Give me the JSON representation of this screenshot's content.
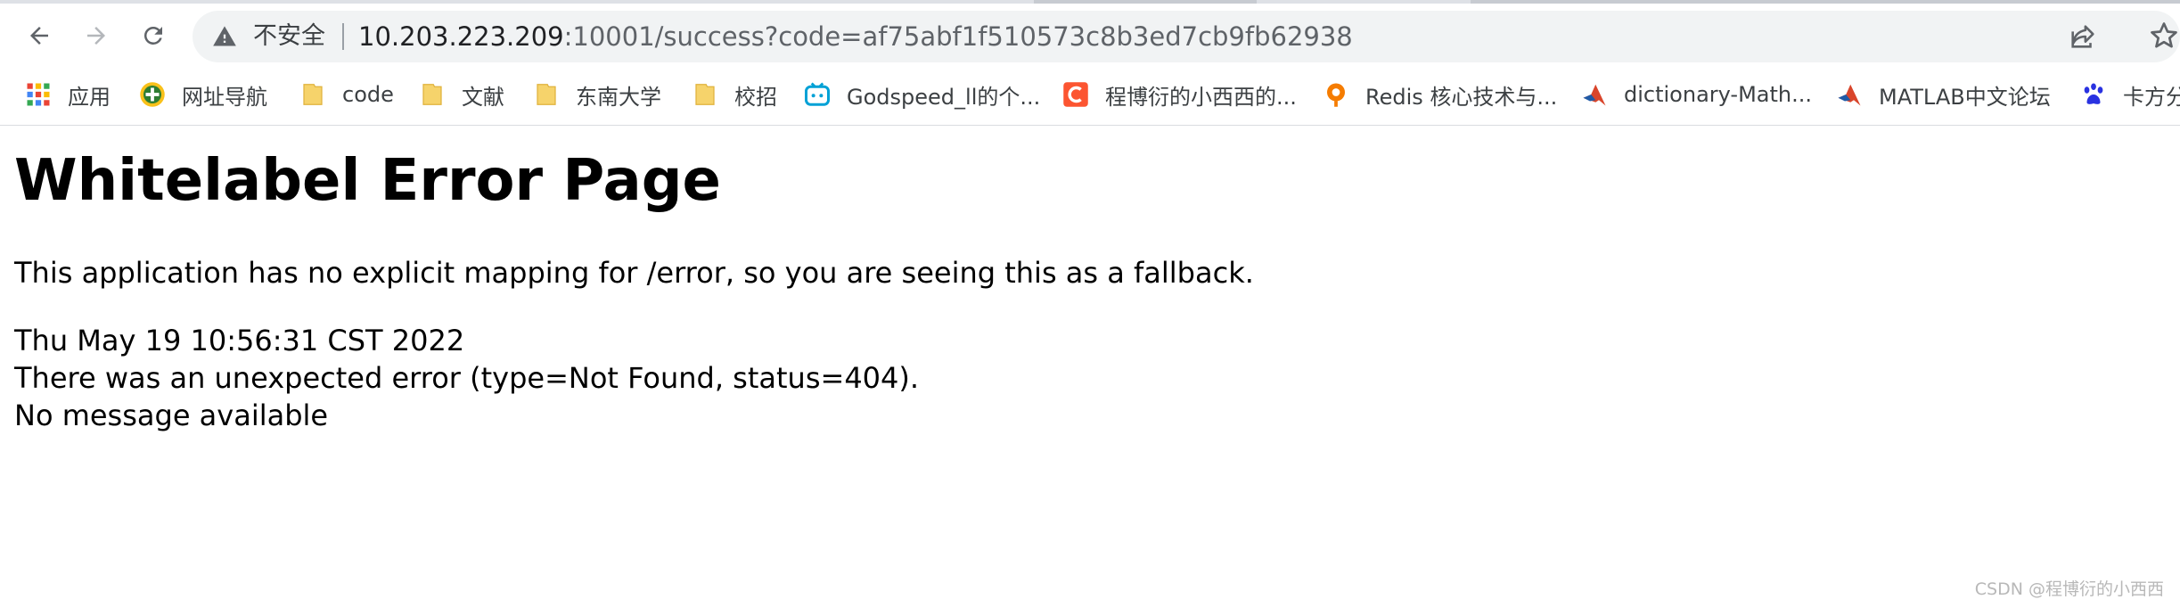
{
  "toolbar": {
    "back_icon": "arrow-left-icon",
    "forward_icon": "arrow-right-icon",
    "reload_icon": "reload-icon"
  },
  "omnibox": {
    "security_label": "不安全",
    "url_host": "10.203.223.209",
    "url_rest": ":10001/success?code=af75abf1f510573c8b3ed7cb9fb62938"
  },
  "bookmarks": [
    {
      "label": "应用",
      "icon": "apps-grid-icon",
      "color": "#ea4335"
    },
    {
      "label": "网址导航",
      "icon": "nav-site-icon",
      "color": "#2e7d32"
    },
    {
      "label": "code",
      "icon": "folder-icon",
      "color": "#f6d36b"
    },
    {
      "label": "文献",
      "icon": "folder-icon",
      "color": "#f6d36b"
    },
    {
      "label": "东南大学",
      "icon": "folder-icon",
      "color": "#f6d36b"
    },
    {
      "label": "校招",
      "icon": "folder-icon",
      "color": "#f6d36b"
    },
    {
      "label": "Godspeed_ll的个...",
      "icon": "bilibili-icon",
      "color": "#00a1d6"
    },
    {
      "label": "程博衍的小西西的...",
      "icon": "csdn-icon",
      "color": "#fc5531"
    },
    {
      "label": "Redis 核心技术与...",
      "icon": "geektime-icon",
      "color": "#f57c00"
    },
    {
      "label": "dictionary-Math...",
      "icon": "matlab-icon",
      "color": "#d9452b"
    },
    {
      "label": "MATLAB中文论坛",
      "icon": "matlab-icon",
      "color": "#d9452b"
    },
    {
      "label": "卡方分",
      "icon": "baidu-paw-icon",
      "color": "#2932e1"
    }
  ],
  "page": {
    "title": "Whitelabel Error Page",
    "description": "This application has no explicit mapping for /error, so you are seeing this as a fallback.",
    "timestamp": "Thu May 19 10:56:31 CST 2022",
    "error_detail": "There was an unexpected error (type=Not Found, status=404).",
    "message": "No message available"
  },
  "watermark": "CSDN @程博衍的小西西"
}
